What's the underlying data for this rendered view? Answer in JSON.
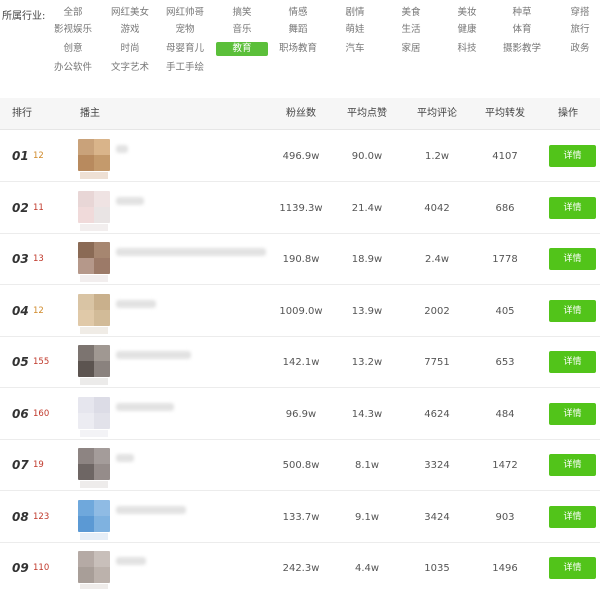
{
  "filter": {
    "label": "所属行业:",
    "categories": [
      [
        "全部",
        "网红美女",
        "网红帅哥",
        "搞笑",
        "情感",
        "剧情",
        "美食",
        "美妆",
        "种草",
        "穿搭"
      ],
      [
        "影视娱乐",
        "游戏",
        "宠物",
        "音乐",
        "舞蹈",
        "萌娃",
        "生活",
        "健康",
        "体育",
        "旅行"
      ],
      [
        "创意",
        "时尚",
        "母婴育儿",
        "教育",
        "职场教育",
        "汽车",
        "家居",
        "科技",
        "摄影教学",
        "政务"
      ],
      [
        "办公软件",
        "文字艺术",
        "手工手绘"
      ]
    ],
    "active": "教育"
  },
  "table": {
    "headers": {
      "rank": "排行",
      "host": "播主",
      "fans": "粉丝数",
      "avg_likes": "平均点赞",
      "avg_comments": "平均评论",
      "avg_shares": "平均转发",
      "action": "操作"
    },
    "detail_label": "详情",
    "rows": [
      {
        "rank": "01",
        "change": "12",
        "fans": "496.9w",
        "likes": "90.0w",
        "comments": "1.2w",
        "shares": "4107",
        "avatar": [
          "#c9a27a",
          "#d9b48a",
          "#b88a5e",
          "#c49a6c"
        ],
        "thumb": "#eee0d4",
        "name_w": 12
      },
      {
        "rank": "02",
        "change": "11",
        "fans": "1139.3w",
        "likes": "21.4w",
        "comments": "4042",
        "shares": "686",
        "avatar": [
          "#e8d6d6",
          "#efe3e3",
          "#f0dada",
          "#e9e4e4"
        ],
        "thumb": "#f2eeee",
        "name_w": 28
      },
      {
        "rank": "03",
        "change": "13",
        "fans": "190.8w",
        "likes": "18.9w",
        "comments": "2.4w",
        "shares": "1778",
        "avatar": [
          "#8a6a55",
          "#a68670",
          "#b5988a",
          "#9c7a68"
        ],
        "thumb": "#f2eeee",
        "name_w": 150
      },
      {
        "rank": "04",
        "change": "12",
        "fans": "1009.0w",
        "likes": "13.9w",
        "comments": "2002",
        "shares": "405",
        "avatar": [
          "#d9c4a4",
          "#c9b08c",
          "#e0c9a8",
          "#d2bb98"
        ],
        "thumb": "#f0ece6",
        "name_w": 40
      },
      {
        "rank": "05",
        "change": "155",
        "fans": "142.1w",
        "likes": "13.2w",
        "comments": "7751",
        "shares": "653",
        "avatar": [
          "#7c7470",
          "#a09892",
          "#5c5450",
          "#8a827e"
        ],
        "thumb": "#ecebea",
        "name_w": 75
      },
      {
        "rank": "06",
        "change": "160",
        "fans": "96.9w",
        "likes": "14.3w",
        "comments": "4624",
        "shares": "484",
        "avatar": [
          "#e6e6ee",
          "#dcdce6",
          "#ececf2",
          "#e2e2ea"
        ],
        "thumb": "#f3f3f6",
        "name_w": 58
      },
      {
        "rank": "07",
        "change": "19",
        "fans": "500.8w",
        "likes": "8.1w",
        "comments": "3324",
        "shares": "1472",
        "avatar": [
          "#8d8482",
          "#a49c9a",
          "#6e6664",
          "#958c8a"
        ],
        "thumb": "#eeeceb",
        "name_w": 18
      },
      {
        "rank": "08",
        "change": "123",
        "fans": "133.7w",
        "likes": "9.1w",
        "comments": "3424",
        "shares": "903",
        "avatar": [
          "#6fa8dc",
          "#8fbbe4",
          "#5b99d4",
          "#7fb2e0"
        ],
        "thumb": "#e6eef7",
        "name_w": 70
      },
      {
        "rank": "09",
        "change": "110",
        "fans": "242.3w",
        "likes": "4.4w",
        "comments": "1035",
        "shares": "1496",
        "avatar": [
          "#b5aaa5",
          "#c8bfba",
          "#a89e98",
          "#bcb2ac"
        ],
        "thumb": "#efecea",
        "name_w": 30
      }
    ]
  }
}
